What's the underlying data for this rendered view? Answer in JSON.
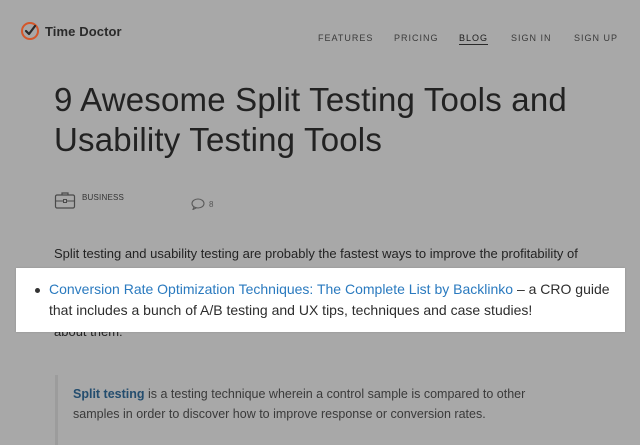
{
  "brand": {
    "name": "Time Doctor",
    "accent": "#e8632a"
  },
  "nav": {
    "items": [
      {
        "label": "FEATURES",
        "active": false
      },
      {
        "label": "PRICING",
        "active": false
      },
      {
        "label": "BLOG",
        "active": true
      },
      {
        "label": "SIGN IN",
        "active": false
      },
      {
        "label": "SIGN UP",
        "active": false
      }
    ]
  },
  "article": {
    "title": "9 Awesome Split Testing Tools and Usability Testing Tools",
    "category": "BUSINESS",
    "comment_count": "8",
    "intro_line": "Split testing and usability testing are probably the fastest ways to improve the profitability of",
    "p2_fragment": "about them:",
    "quote": {
      "link_text": "Split testing",
      "text": " is a testing technique wherein a control sample is compared to other samples in order to discover how to improve response or conversion rates."
    }
  },
  "highlight": {
    "link_text": "Conversion Rate Optimization Techniques: The Complete List by Backlinko",
    "text": " – a CRO guide that includes a bunch of A/B testing and UX tips, techniques and case studies!",
    "link_color": "#2a7abf"
  }
}
